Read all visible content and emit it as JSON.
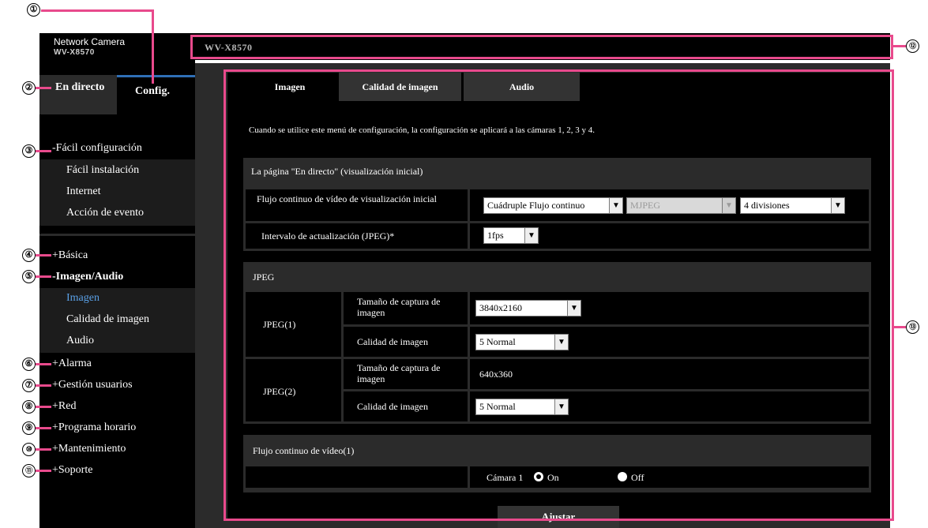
{
  "sidebar": {
    "brand": "Network Camera",
    "model": "WV-X8570",
    "tab_live": "En directo",
    "tab_config": "Config.",
    "easy_setup": {
      "title": "-Fácil configuración",
      "items": [
        "Fácil instalación",
        "Internet",
        "Acción de evento"
      ]
    },
    "basic": "+Básica",
    "image_audio": {
      "title": "-Imagen/Audio",
      "items": [
        "Imagen",
        "Calidad de imagen",
        "Audio"
      ]
    },
    "alarm": "+Alarma",
    "user_mng": "+Gestión usuarios",
    "network": "+Red",
    "schedule": "+Programa horario",
    "maintenance": "+Mantenimiento",
    "support": "+Soporte"
  },
  "topbar": {
    "model": "WV-X8570"
  },
  "tabs": {
    "image": "Imagen",
    "quality": "Calidad de imagen",
    "audio": "Audio"
  },
  "info_text": "Cuando se utilice este menú de configuración, la configuración se aplicará a las cámaras 1, 2, 3 y 4.",
  "live_page": {
    "title": "La página \"En directo\" (visualización inicial)",
    "stream_label": "Flujo continuo de vídeo de visualización inicial",
    "stream_value": "Cuádruple Flujo continuo",
    "codec_value": "MJPEG",
    "split_value": "4 divisiones",
    "refresh_label": "Intervalo de actualización (JPEG)*",
    "refresh_value": "1fps"
  },
  "jpeg": {
    "title": "JPEG",
    "jpeg1": {
      "name": "JPEG(1)",
      "size_label": "Tamaño de captura de imagen",
      "size_value": "3840x2160",
      "quality_label": "Calidad de imagen",
      "quality_value": "5 Normal"
    },
    "jpeg2": {
      "name": "JPEG(2)",
      "size_label": "Tamaño de captura de imagen",
      "size_value": "640x360",
      "quality_label": "Calidad de imagen",
      "quality_value": "5 Normal"
    }
  },
  "stream1": {
    "title": "Flujo continuo de vídeo(1)",
    "camera": "Cámara 1",
    "on": "On",
    "off": "Off"
  },
  "set_button": "Ajustar",
  "callouts": [
    "①",
    "②",
    "③",
    "④",
    "⑤",
    "⑥",
    "⑦",
    "⑧",
    "⑨",
    "⑩",
    "⑪",
    "⑫",
    "⑬"
  ],
  "colors": {
    "accent_pink": "#e84a8c",
    "active_blue": "#5aa0e6",
    "tab_blue": "#2f6fb6"
  }
}
